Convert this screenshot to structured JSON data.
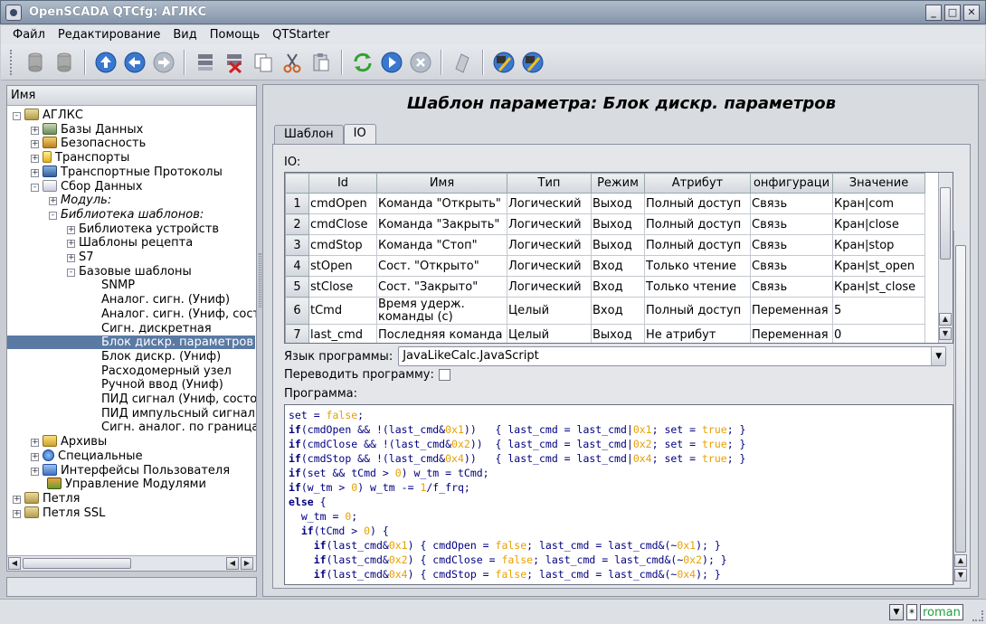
{
  "window": {
    "title": "OpenSCADA QTCfg: АГЛКС"
  },
  "menu": [
    "Файл",
    "Редактирование",
    "Вид",
    "Помощь",
    "QTStarter"
  ],
  "toolbar_icons": [
    "db-load-icon",
    "db-save-icon",
    "up-icon",
    "back-icon",
    "forward-icon",
    "add-item-icon",
    "delete-item-icon",
    "copy-icon",
    "cut-icon",
    "paste-icon",
    "refresh-icon",
    "start-icon",
    "stop-icon",
    "info-icon",
    "cfg-icon",
    "cfg-wide-icon"
  ],
  "tree": {
    "header": "Имя",
    "items": [
      {
        "label": "АГЛКС",
        "level": 0,
        "toggle": "-",
        "icon": "folder"
      },
      {
        "label": "Базы Данных",
        "level": 1,
        "toggle": "+",
        "icon": "db"
      },
      {
        "label": "Безопасность",
        "level": 1,
        "toggle": "+",
        "icon": "sec"
      },
      {
        "label": "Транспорты",
        "level": 1,
        "toggle": "+",
        "icon": "tr"
      },
      {
        "label": "Транспортные Протоколы",
        "level": 1,
        "toggle": "+",
        "icon": "proto"
      },
      {
        "label": "Сбор Данных",
        "level": 1,
        "toggle": "-",
        "icon": "daq"
      },
      {
        "label": "Модуль:",
        "level": 2,
        "toggle": "+",
        "icon": "",
        "italic": true
      },
      {
        "label": "Библиотека шаблонов:",
        "level": 2,
        "toggle": "-",
        "icon": "",
        "italic": true
      },
      {
        "label": "Библиотека устройств",
        "level": 3,
        "toggle": "+",
        "icon": ""
      },
      {
        "label": "Шаблоны рецепта",
        "level": 3,
        "toggle": "+",
        "icon": ""
      },
      {
        "label": "S7",
        "level": 3,
        "toggle": "+",
        "icon": ""
      },
      {
        "label": "Базовые шаблоны",
        "level": 3,
        "toggle": "-",
        "icon": ""
      },
      {
        "label": "SNMP",
        "level": 4,
        "toggle": "",
        "icon": ""
      },
      {
        "label": "Аналог. сигн. (Униф)",
        "level": 4,
        "toggle": "",
        "icon": ""
      },
      {
        "label": "Аналог. сигн. (Униф, сост",
        "level": 4,
        "toggle": "",
        "icon": ""
      },
      {
        "label": "Сигн. дискретная",
        "level": 4,
        "toggle": "",
        "icon": ""
      },
      {
        "label": "Блок дискр. параметров",
        "level": 4,
        "toggle": "",
        "icon": "",
        "selected": true
      },
      {
        "label": "Блок дискр. (Униф)",
        "level": 4,
        "toggle": "",
        "icon": ""
      },
      {
        "label": "Расходомерный узел",
        "level": 4,
        "toggle": "",
        "icon": ""
      },
      {
        "label": "Ручной ввод (Униф)",
        "level": 4,
        "toggle": "",
        "icon": ""
      },
      {
        "label": "ПИД сигнал (Униф, состо",
        "level": 4,
        "toggle": "",
        "icon": ""
      },
      {
        "label": "ПИД импульсный сигнал",
        "level": 4,
        "toggle": "",
        "icon": ""
      },
      {
        "label": "Сигн. аналог. по граница",
        "level": 4,
        "toggle": "",
        "icon": ""
      },
      {
        "label": "Архивы",
        "level": 1,
        "toggle": "+",
        "icon": "arh"
      },
      {
        "label": "Специальные",
        "level": 1,
        "toggle": "+",
        "icon": "spec"
      },
      {
        "label": "Интерфейсы Пользователя",
        "level": 1,
        "toggle": "+",
        "icon": "ui"
      },
      {
        "label": "Управление Модулями",
        "level": 1,
        "toggle": "",
        "icon": "mod"
      },
      {
        "label": "Петля",
        "level": 0,
        "toggle": "+",
        "icon": "folder"
      },
      {
        "label": "Петля SSL",
        "level": 0,
        "toggle": "+",
        "icon": "folder"
      }
    ]
  },
  "page": {
    "title": "Шаблон параметра: Блок дискр. параметров",
    "tabs": [
      "Шаблон",
      "IO"
    ],
    "active_tab": 1,
    "io_label": "IO:",
    "columns": [
      "Id",
      "Имя",
      "Тип",
      "Режим",
      "Атрибут",
      "онфигураци",
      "Значение"
    ],
    "rows": [
      [
        "1",
        "cmdOpen",
        "Команда \"Открыть\"",
        "Логический",
        "Выход",
        "Полный доступ",
        "Связь",
        "Кран|com"
      ],
      [
        "2",
        "cmdClose",
        "Команда \"Закрыть\"",
        "Логический",
        "Выход",
        "Полный доступ",
        "Связь",
        "Кран|close"
      ],
      [
        "3",
        "cmdStop",
        "Команда \"Стоп\"",
        "Логический",
        "Выход",
        "Полный доступ",
        "Связь",
        "Кран|stop"
      ],
      [
        "4",
        "stOpen",
        "Сост. \"Открыто\"",
        "Логический",
        "Вход",
        "Только чтение",
        "Связь",
        "Кран|st_open"
      ],
      [
        "5",
        "stClose",
        "Сост. \"Закрыто\"",
        "Логический",
        "Вход",
        "Только чтение",
        "Связь",
        "Кран|st_close"
      ],
      [
        "6",
        "tCmd",
        "Время удерж. команды (с)",
        "Целый",
        "Вход",
        "Полный доступ",
        "Переменная",
        "5"
      ],
      [
        "7",
        "last_cmd",
        "Последняя команда",
        "Целый",
        "Выход",
        "Не атрибут",
        "Переменная",
        "0"
      ]
    ],
    "lang_label": "Язык программы:",
    "lang_value": "JavaLikeCalc.JavaScript",
    "translate_label": "Переводить программу:",
    "program_label": "Программа:",
    "program": [
      "set = false;",
      "if(cmdOpen && !(last_cmd&0x1))   { last_cmd = last_cmd|0x1; set = true; }",
      "if(cmdClose && !(last_cmd&0x2))  { last_cmd = last_cmd|0x2; set = true; }",
      "if(cmdStop && !(last_cmd&0x4))   { last_cmd = last_cmd|0x4; set = true; }",
      "if(set && tCmd > 0) w_tm = tCmd;",
      "if(w_tm > 0) w_tm -= 1/f_frq;",
      "else {",
      "  w_tm = 0;",
      "  if(tCmd > 0) {",
      "    if(last_cmd&0x1) { cmdOpen = false; last_cmd = last_cmd&(~0x1); }",
      "    if(last_cmd&0x2) { cmdClose = false; last_cmd = last_cmd&(~0x2); }",
      "    if(last_cmd&0x4) { cmdStop = false; last_cmd = last_cmd&(~0x4); }"
    ]
  },
  "status": {
    "modified": "*",
    "user": "roman"
  }
}
